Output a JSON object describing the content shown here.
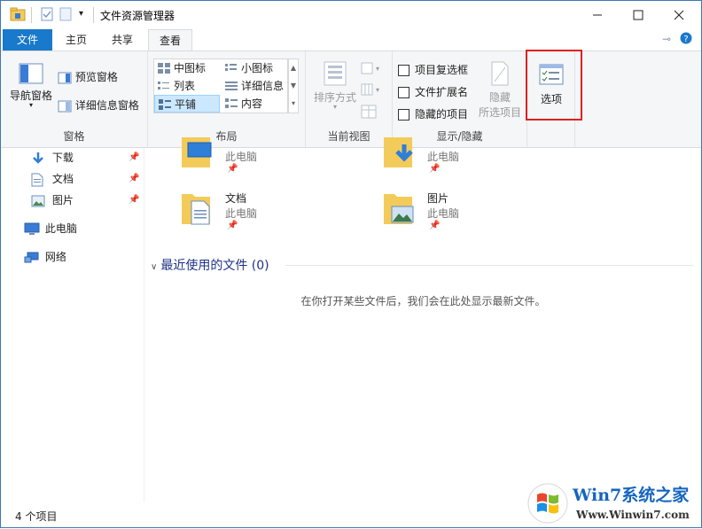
{
  "window": {
    "title": "文件资源管理器"
  },
  "tabs": [
    {
      "label": "文件"
    },
    {
      "label": "主页"
    },
    {
      "label": "共享"
    },
    {
      "label": "查看"
    }
  ],
  "ribbon": {
    "panes": {
      "nav_pane": "导航窗格",
      "preview_pane": "预览窗格",
      "details_pane": "详细信息窗格",
      "group_label": "窗格"
    },
    "layout": {
      "items": [
        "中图标",
        "小图标",
        "列表",
        "详细信息",
        "平铺",
        "内容"
      ],
      "selected": "平铺",
      "group_label": "布局"
    },
    "current_view": {
      "sort_by": "排序方式",
      "group_label": "当前视图"
    },
    "show_hide": {
      "item_checkboxes": "项目复选框",
      "file_extensions": "文件扩展名",
      "hidden_items": "隐藏的项目",
      "hide_selected_1": "隐藏",
      "hide_selected_2": "所选项目",
      "group_label": "显示/隐藏"
    },
    "options": {
      "label": "选项"
    }
  },
  "nav": {
    "items": [
      {
        "label": "下载",
        "icon": "download-arrow-icon",
        "pinned": true
      },
      {
        "label": "文档",
        "icon": "document-icon",
        "pinned": true
      },
      {
        "label": "图片",
        "icon": "pictures-icon",
        "pinned": true
      },
      {
        "label": "此电脑",
        "icon": "computer-icon"
      },
      {
        "label": "网络",
        "icon": "network-icon"
      }
    ]
  },
  "content": {
    "folders": [
      {
        "name": "",
        "location": "此电脑",
        "icon": "desktop-folder-icon"
      },
      {
        "name": "",
        "location": "此电脑",
        "icon": "downloads-folder-icon"
      },
      {
        "name": "文档",
        "location": "此电脑",
        "icon": "documents-folder-icon"
      },
      {
        "name": "图片",
        "location": "此电脑",
        "icon": "pictures-folder-icon"
      }
    ],
    "recent_header": "最近使用的文件 (0)",
    "empty_message": "在你打开某些文件后，我们会在此处显示最新文件。"
  },
  "status": {
    "count": "4 个项目"
  },
  "watermark": {
    "brand": "Win7系统之家",
    "url": "Www.Winwin7.com"
  },
  "colors": {
    "accent": "#1979ca",
    "highlight_box": "#e02020",
    "section_header": "#1e3287",
    "folder_yellow": "#f3cb5a"
  }
}
